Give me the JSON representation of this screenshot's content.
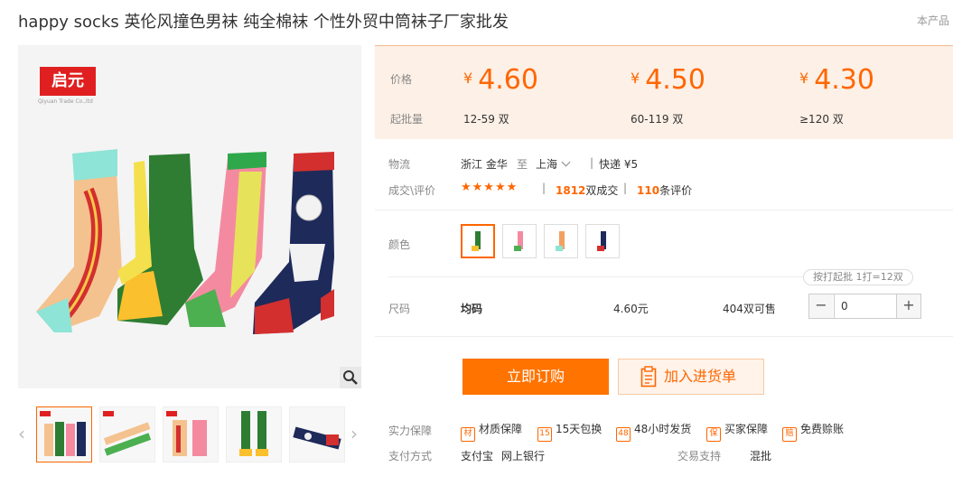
{
  "product": {
    "title": "happy socks 英伦风撞色男袜 纯全棉袜 个性外贸中筒袜子厂家批发",
    "notice_text": "本产品"
  },
  "gallery": {
    "brand_text": "启元",
    "brand_subtext": "Qiyuan Trade Co.,ltd"
  },
  "pricing": {
    "price_label": "价格",
    "moq_label": "起批量",
    "tiers": [
      {
        "currency": "¥",
        "price": "4.60",
        "range": "12-59 双"
      },
      {
        "currency": "¥",
        "price": "4.50",
        "range": "60-119 双"
      },
      {
        "currency": "¥",
        "price": "4.30",
        "range": "≥120 双"
      }
    ]
  },
  "logistics": {
    "label": "物流",
    "origin": "浙江 金华",
    "to": "至",
    "destination": "上海",
    "shipping": "快递 ¥5"
  },
  "transactions": {
    "label": "成交\\评价",
    "stars": "★★★★★",
    "deal_count": "1812",
    "deal_suffix": "双成交",
    "review_count": "110",
    "review_suffix": "条评价"
  },
  "color": {
    "label": "颜色"
  },
  "size": {
    "tip": "按打起批 1打=12双",
    "label": "尺码",
    "value": "均码",
    "price": "4.60元",
    "stock": "404双可售",
    "quantity": "0",
    "minus": "−",
    "plus": "+"
  },
  "actions": {
    "buy_label": "立即订购",
    "cart_label": "加入进货单"
  },
  "guarantee": {
    "label": "实力保障",
    "items": [
      {
        "icon_char": "材",
        "text": "材质保障"
      },
      {
        "icon_char": "15",
        "text": "15天包换"
      },
      {
        "icon_char": "48",
        "text": "48小时发货"
      },
      {
        "icon_char": "保",
        "text": "买家保障"
      },
      {
        "icon_char": "赔",
        "text": "免费赊账"
      }
    ]
  },
  "payment": {
    "label": "支付方式",
    "methods": [
      "支付宝",
      "网上银行"
    ],
    "trade_label": "交易支持",
    "trade_value": "混批"
  },
  "colors": {
    "accent": "#ff6600",
    "button": "#ff7300",
    "price_bg": "#fdf0e6"
  }
}
